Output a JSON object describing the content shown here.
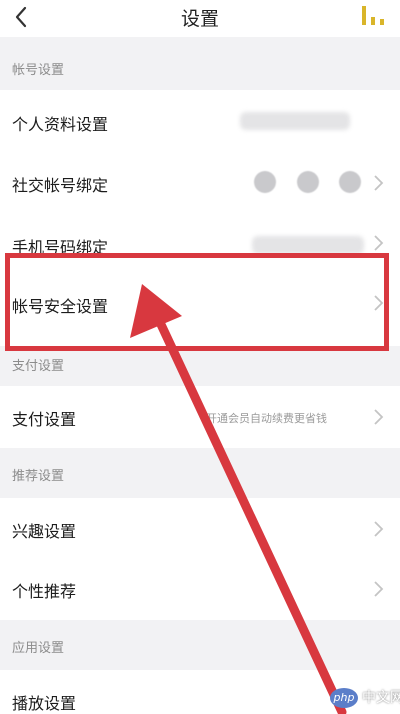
{
  "header": {
    "title": "设置",
    "back_icon": "chevron-left-icon",
    "right_icon": "bars-icon",
    "right_icon_color": "#d9b52a"
  },
  "sections": {
    "account": "帐号设置",
    "payment": "支付设置",
    "recommend": "推荐设置",
    "app": "应用设置"
  },
  "rows": {
    "profile": "个人资料设置",
    "social_binding": "社交帐号绑定",
    "phone_binding": "手机号码绑定",
    "account_security": "帐号安全设置",
    "payment": "支付设置",
    "payment_value": "开通会员自动续费更省钱",
    "interest": "兴趣设置",
    "personal_recommend": "个性推荐",
    "playback": "播放设置"
  },
  "annotation": {
    "highlight_color": "#d8383f"
  },
  "watermark": {
    "logo": "php",
    "text": "中文网"
  }
}
